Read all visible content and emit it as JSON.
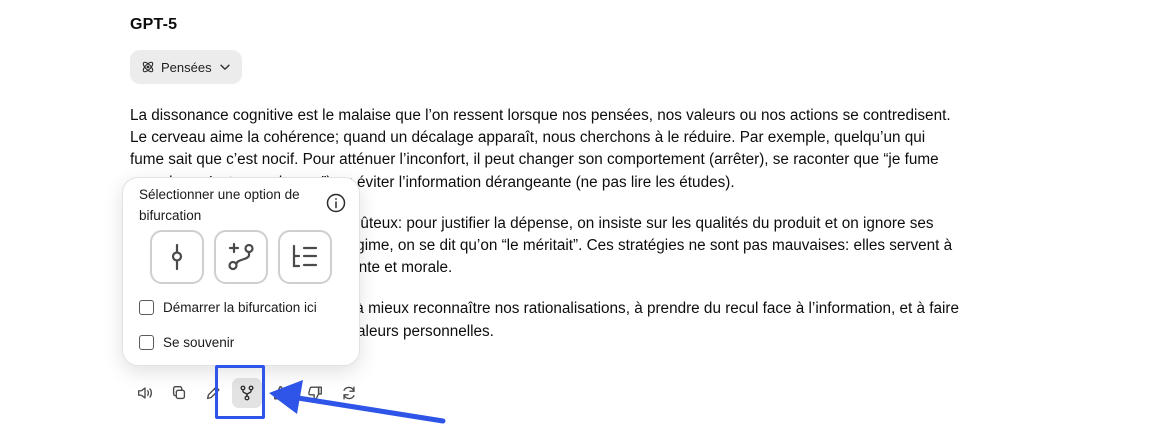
{
  "model_name": "GPT-5",
  "thoughts": {
    "label": "Pensées",
    "icon": "atom-icon",
    "chevron_icon": "chevron-down-icon"
  },
  "message": {
    "paragraphs": [
      "La dissonance cognitive est le malaise que l’on ressent lorsque nos pensées, nos valeurs ou nos actions se contredisent. Le cerveau aime la cohérence; quand un décalage apparaît, nous cherchons à le réduire. Par exemple, quelqu’un qui fume sait que c’est nocif. Pour atténuer l’inconfort, il peut changer son comportement (arrêter), se raconter que “je fume peu, donc c’est sans danger”) ou éviter l’information dérangeante (ne pas lire les études).",
      "On la voit aussi après un achat coûteux: pour justifier la dépense, on insiste sur les qualités du produit et on ignore ses défauts. Ou lorsqu’on triche au régime, on se dit qu’on “le méritait”. Ces stratégies ne sont pas mauvaises: elles servent à protéger une image de soi cohérente et morale.",
      "Comprendre ce mécanisme aide à mieux reconnaître nos rationalisations, à prendre du recul face à l’information, et à faire des choix plus alignés avec nos valeurs personnelles."
    ]
  },
  "actions": [
    {
      "name": "read-aloud-button",
      "icon": "speaker-icon"
    },
    {
      "name": "copy-button",
      "icon": "copy-icon"
    },
    {
      "name": "edit-button",
      "icon": "pencil-icon"
    },
    {
      "name": "branch-button",
      "icon": "branch-icon",
      "active": true
    },
    {
      "name": "thumbs-up-button",
      "icon": "thumbs-up-icon"
    },
    {
      "name": "thumbs-down-button",
      "icon": "thumbs-down-icon"
    },
    {
      "name": "regenerate-button",
      "icon": "refresh-icon"
    }
  ],
  "branch_popover": {
    "title": "Sélectionner une option de bifurcation",
    "info_icon": "info-icon",
    "options": [
      {
        "name": "branch-option-single",
        "icon": "commit-node-icon"
      },
      {
        "name": "branch-option-new",
        "icon": "branch-add-icon"
      },
      {
        "name": "branch-option-list",
        "icon": "list-tree-icon"
      }
    ],
    "checkboxes": [
      {
        "label": "Démarrer la bifurcation ici",
        "checked": false
      },
      {
        "label": "Se souvenir",
        "checked": false
      }
    ]
  },
  "colors": {
    "annotation_blue": "#2f55e8",
    "active_button_bg": "#e3e3e3",
    "pill_bg": "#ececec"
  }
}
